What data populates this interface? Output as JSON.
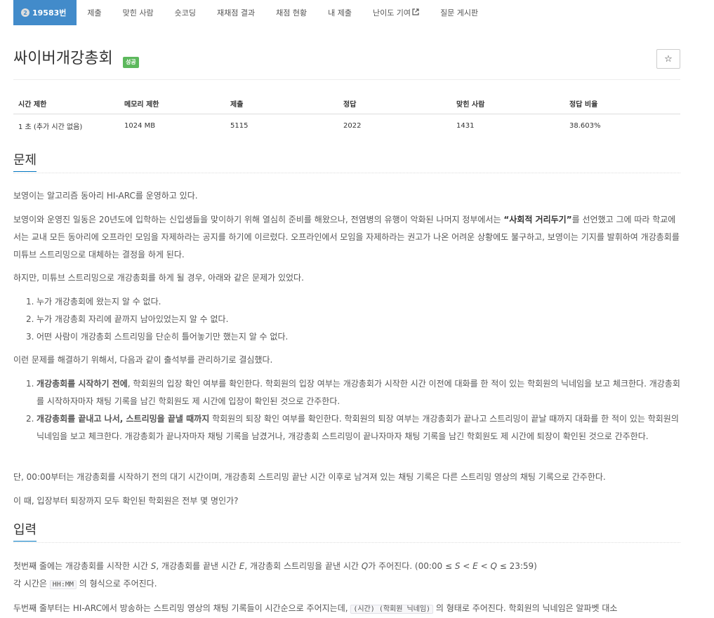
{
  "tabs": [
    {
      "label": "19583번",
      "tier": "2"
    },
    {
      "label": "제출"
    },
    {
      "label": "맞힌 사람"
    },
    {
      "label": "숏코딩"
    },
    {
      "label": "재채점 결과"
    },
    {
      "label": "채점 현황"
    },
    {
      "label": "내 제출"
    },
    {
      "label": "난이도 기여"
    },
    {
      "label": "질문 게시판"
    }
  ],
  "problem": {
    "title": "싸이버개강총회",
    "status_badge": "성공",
    "star_icon": "☆"
  },
  "info": {
    "headers": [
      "시간 제한",
      "메모리 제한",
      "제출",
      "정답",
      "맞힌 사람",
      "정답 비율"
    ],
    "values": [
      "1 초 (추가 시간 없음)",
      "1024 MB",
      "5115",
      "2022",
      "1431",
      "38.603%"
    ]
  },
  "section_problem": {
    "title": "문제",
    "p1": "보영이는 알고리즘 동아리 HI-ARC를 운영하고 있다.",
    "p2_a": "보영이와 운영진 일동은 20년도에 입학하는 신입생들을 맞이하기 위해 열심히 준비를 해왔으나, 전염병의 유행이 악화된 나머지 정부에서는 ",
    "p2_b": "“사회적 거리두기”",
    "p2_c": "를 선언했고 그에 따라 학교에서는 교내 모든 동아리에 오프라인 모임을 자제하라는 공지를 하기에 이르렀다. 오프라인에서 모임을 자제하라는 권고가 나온 어려운 상황에도 불구하고, 보영이는 기지를 발휘하여 개강총회를 미튜브 스트리밍으로 대체하는 결정을 하게 된다.",
    "p3": "하지만, 미튜브 스트리밍으로 개강총회를 하게 될 경우, 아래와 같은 문제가 있었다.",
    "issues": [
      "누가 개강총회에 왔는지 알 수 없다.",
      "누가 개강총회 자리에 끝까지 남아있었는지 알 수 없다.",
      "어떤 사람이 개강총회 스트리밍을 단순히 틀어놓기만 했는지 알 수 없다."
    ],
    "p4": "이런 문제를 해결하기 위해서, 다음과 같이 출석부를 관리하기로 결심했다.",
    "rule1_bold": "개강총회를 시작하기 전에",
    "rule1_text": ", 학회원의 입장 확인 여부를 확인한다. 학회원의 입장 여부는 개강총회가 시작한 시간 이전에 대화를 한 적이 있는 학회원의 닉네임을 보고 체크한다. 개강총회를 시작하자마자 채팅 기록을 남긴 학회원도 제 시간에 입장이 확인된 것으로 간주한다.",
    "rule2_bold": "개강총회를 끝내고 나서, 스트리밍을 끝낼 때까지",
    "rule2_text": " 학회원의 퇴장 확인 여부를 확인한다. 학회원의 퇴장 여부는 개강총회가 끝나고 스트리밍이 끝날 때까지 대화를 한 적이 있는 학회원의 닉네임을 보고 체크한다. 개강총회가 끝나자마자 채팅 기록을 남겼거나, 개강총회 스트리밍이 끝나자마자 채팅 기록을 남긴 학회원도 제 시간에 퇴장이 확인된 것으로 간주한다.",
    "p5": "단, 00:00부터는 개강총회를 시작하기 전의 대기 시간이며, 개강총회 스트리밍 끝난 시간 이후로 남겨져 있는 채팅 기록은 다른 스트리밍 영상의 채팅 기록으로 간주한다.",
    "p6": "이 때, 입장부터 퇴장까지 모두 확인된 학회원은 전부 몇 명인가?"
  },
  "section_input": {
    "title": "입력",
    "l1_a": "첫번째 줄에는 개강총회를 시작한 시간 ",
    "l1_S": "S",
    "l1_b": ", 개강총회를 끝낸 시간 ",
    "l1_E": "E",
    "l1_c": ", 개강총회 스트리밍을 끝낸 시간 ",
    "l1_Q": "Q",
    "l1_d": "가 주어진다. (00:00 ≤ ",
    "l1_e": " < ",
    "l1_f": " < ",
    "l1_g": " ≤ 23:59)",
    "l2_a": "각 시간은 ",
    "l2_code": "HH:MM",
    "l2_b": " 의 형식으로 주어진다.",
    "l3_a": "두번째 줄부터는 HI-ARC에서 방송하는 스트리밍 영상의 채팅 기록들이 시간순으로 주어지는데, ",
    "l3_code": "(시간) (학회원 닉네임)",
    "l3_b": " 의 형태로 주어진다. 학회원의 닉네임은 알파벳 대소"
  }
}
